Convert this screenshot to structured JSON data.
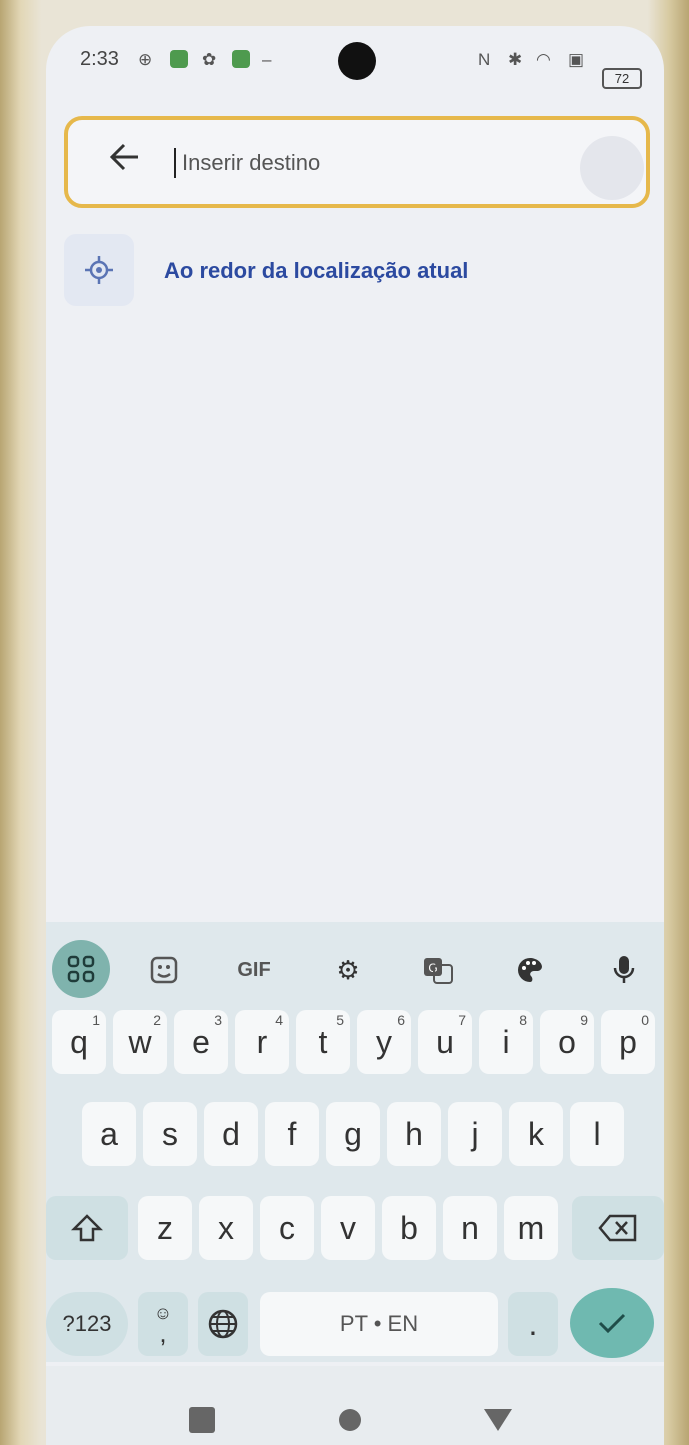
{
  "status_bar": {
    "time": "2:33",
    "battery": "72"
  },
  "search": {
    "placeholder": "Inserir destino",
    "value": ""
  },
  "suggestion": {
    "label": "Ao redor da localização atual",
    "icon": "crosshair-icon"
  },
  "keyboard": {
    "toolbar": {
      "gif_label": "GIF",
      "icons": [
        "apps-grid-icon",
        "sticker-icon",
        "gif-icon",
        "settings-icon",
        "translate-icon",
        "palette-icon",
        "microphone-icon"
      ]
    },
    "row1": [
      {
        "k": "q",
        "n": "1"
      },
      {
        "k": "w",
        "n": "2"
      },
      {
        "k": "e",
        "n": "3"
      },
      {
        "k": "r",
        "n": "4"
      },
      {
        "k": "t",
        "n": "5"
      },
      {
        "k": "y",
        "n": "6"
      },
      {
        "k": "u",
        "n": "7"
      },
      {
        "k": "i",
        "n": "8"
      },
      {
        "k": "o",
        "n": "9"
      },
      {
        "k": "p",
        "n": "0"
      }
    ],
    "row2": [
      "a",
      "s",
      "d",
      "f",
      "g",
      "h",
      "j",
      "k",
      "l"
    ],
    "row3": [
      "z",
      "x",
      "c",
      "v",
      "b",
      "n",
      "m"
    ],
    "symbols_label": "?123",
    "comma_label": ",",
    "space_label": "PT • EN",
    "period_label": "."
  },
  "nav": {
    "icons": [
      "recents-square-icon",
      "home-circle-icon",
      "back-triangle-icon"
    ]
  }
}
